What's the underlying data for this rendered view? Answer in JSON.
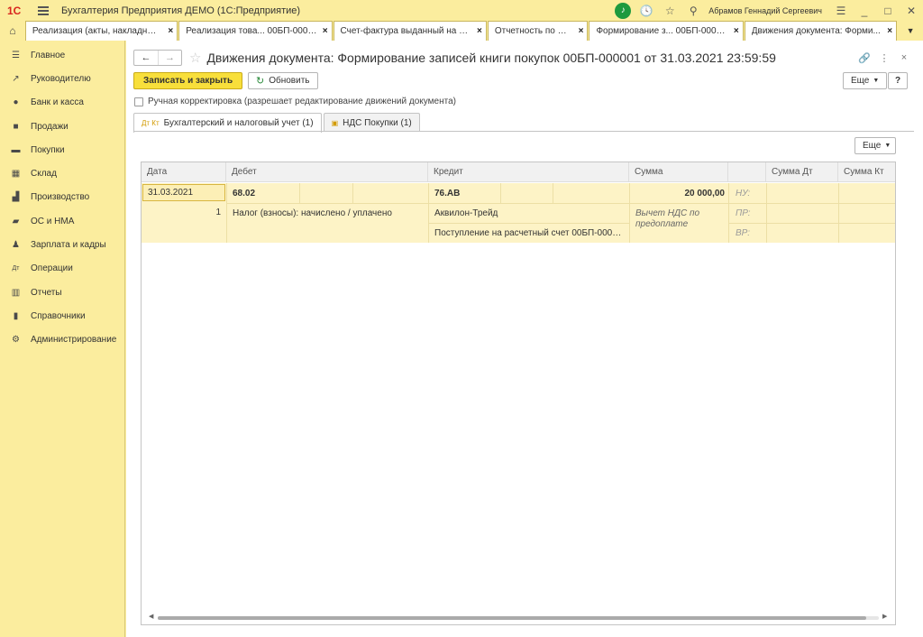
{
  "app": {
    "logo": "1С",
    "title": "Бухгалтерия Предприятия ДЕМО  (1С:Предприятие)",
    "user": "Абрамов Геннадий Сергеевич"
  },
  "tabs": [
    {
      "label": "Реализация (акты, накладные..."
    },
    {
      "label": "Реализация това... 00БП-000001"
    },
    {
      "label": "Счет-фактура выданный на ре..."
    },
    {
      "label": "Отчетность по НДС"
    },
    {
      "label": "Формирование з... 00БП-000001"
    },
    {
      "label": "Движения документа: Форми..."
    }
  ],
  "sidebar": {
    "items": [
      {
        "label": "Главное"
      },
      {
        "label": "Руководителю"
      },
      {
        "label": "Банк и касса"
      },
      {
        "label": "Продажи"
      },
      {
        "label": "Покупки"
      },
      {
        "label": "Склад"
      },
      {
        "label": "Производство"
      },
      {
        "label": "ОС и НМА"
      },
      {
        "label": "Зарплата и кадры"
      },
      {
        "label": "Операции"
      },
      {
        "label": "Отчеты"
      },
      {
        "label": "Справочники"
      },
      {
        "label": "Администрирование"
      }
    ]
  },
  "document": {
    "title": "Движения документа: Формирование записей книги покупок 00БП-000001 от 31.03.2021 23:59:59"
  },
  "toolbar": {
    "save_close": "Записать и закрыть",
    "refresh": "Обновить",
    "more": "Еще",
    "help": "?"
  },
  "manual_edit": {
    "label": "Ручная корректировка (разрешает редактирование движений документа)"
  },
  "form_tabs": [
    {
      "label": "Бухгалтерский и налоговый учет (1)",
      "icon_text": "Дт Кт"
    },
    {
      "label": "НДС Покупки (1)"
    }
  ],
  "table": {
    "more": "Еще",
    "headers": {
      "date": "Дата",
      "debit": "Дебет",
      "credit": "Кредит",
      "sum": "Сумма",
      "sum_dt": "Сумма Дт",
      "sum_kt": "Сумма Кт"
    },
    "row": {
      "date": "31.03.2021",
      "number": "1",
      "debit_account": "68.02",
      "debit_sub1": "Налог (взносы): начислено / уплачено",
      "credit_account": "76.АВ",
      "credit_sub1": "Аквилон-Трейд",
      "credit_sub2": "Поступление на расчетный счет 00БП-00000...",
      "sum": "20 000,00",
      "content": "Вычет НДС по предоплате",
      "nu": "НУ:",
      "pr": "ПР:",
      "vr": "ВР:"
    }
  }
}
